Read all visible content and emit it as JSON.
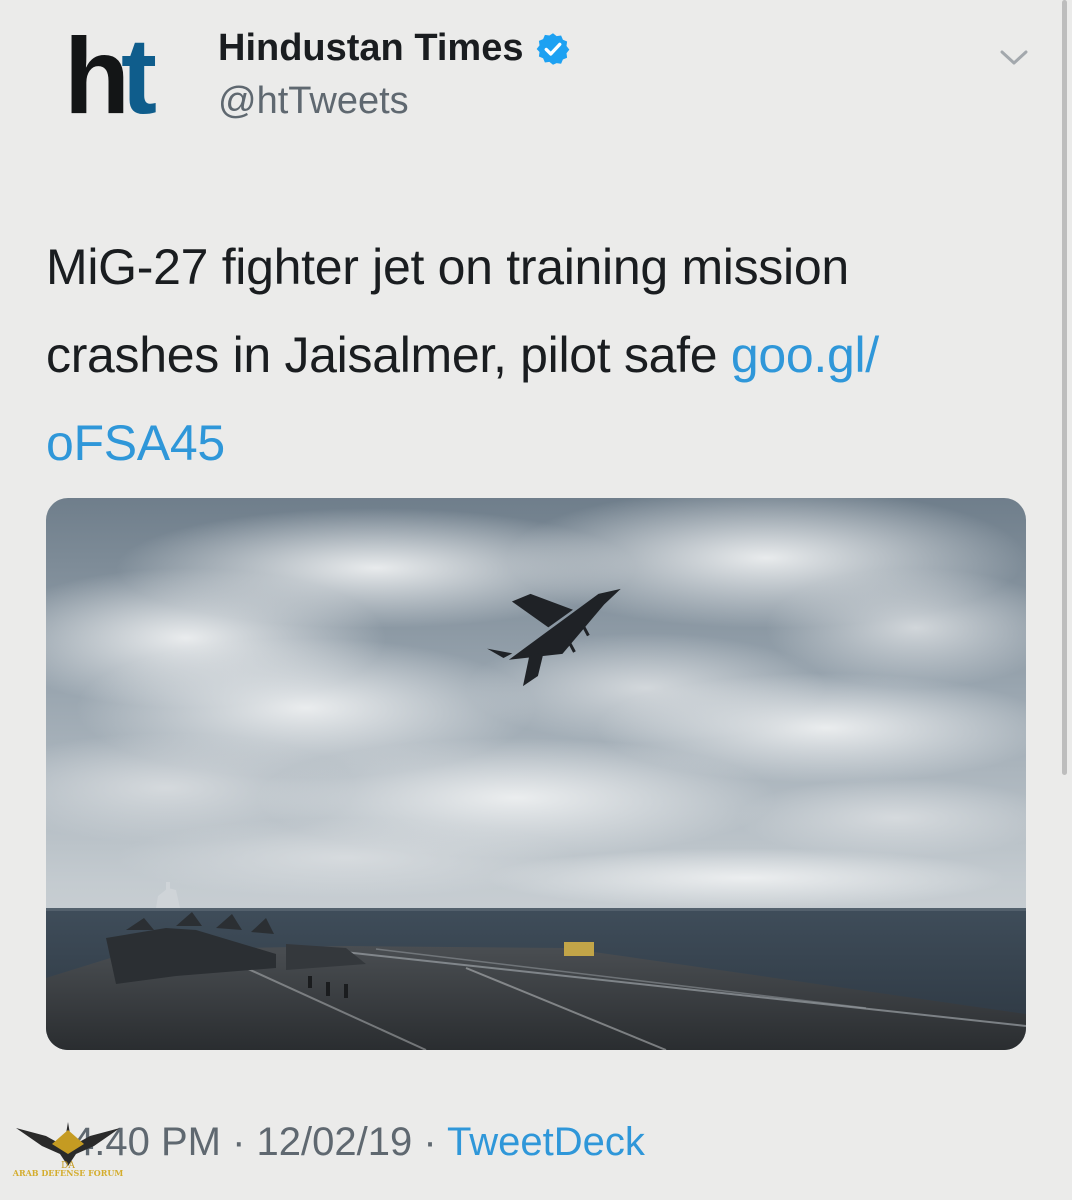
{
  "header": {
    "logo": {
      "part1": "h",
      "part2": "t"
    },
    "account_name": "Hindustan Times",
    "handle": "@htTweets",
    "verified_icon": "verified-badge-icon",
    "menu_icon": "chevron-down-icon"
  },
  "tweet": {
    "text": "MiG-27 fighter jet on training mission crashes in Jaisalmer, pilot safe ",
    "link_line1": "goo.gl/",
    "link_line2": "oFSA45"
  },
  "media": {
    "description_icon": "photo"
  },
  "footer": {
    "time": "4:40 PM",
    "separator": " · ",
    "date": "12/02/19",
    "source": "TweetDeck"
  },
  "watermark": {
    "label": "ARAB DEFENSE FORUM"
  },
  "colors": {
    "background": "#ebebea",
    "link": "#2f97d9",
    "verified": "#1da1f2",
    "logo_t": "#0f5d8c"
  }
}
